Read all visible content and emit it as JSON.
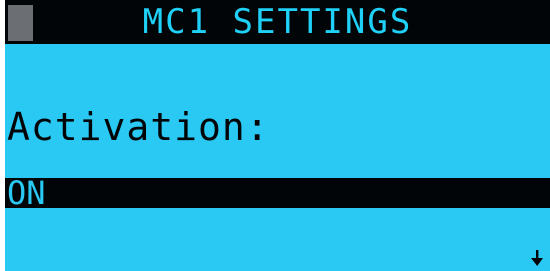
{
  "header": {
    "title": "MC1 SETTINGS"
  },
  "setting": {
    "label": "Activation:",
    "value": "ON"
  },
  "icons": {
    "status_block": "status-block-icon",
    "scroll": "arrow-down-icon"
  },
  "colors": {
    "lcd_background": "#29c9f4",
    "bar_background": "#020507",
    "title_text": "#1fd0f7",
    "status_block": "#6b6e72"
  }
}
